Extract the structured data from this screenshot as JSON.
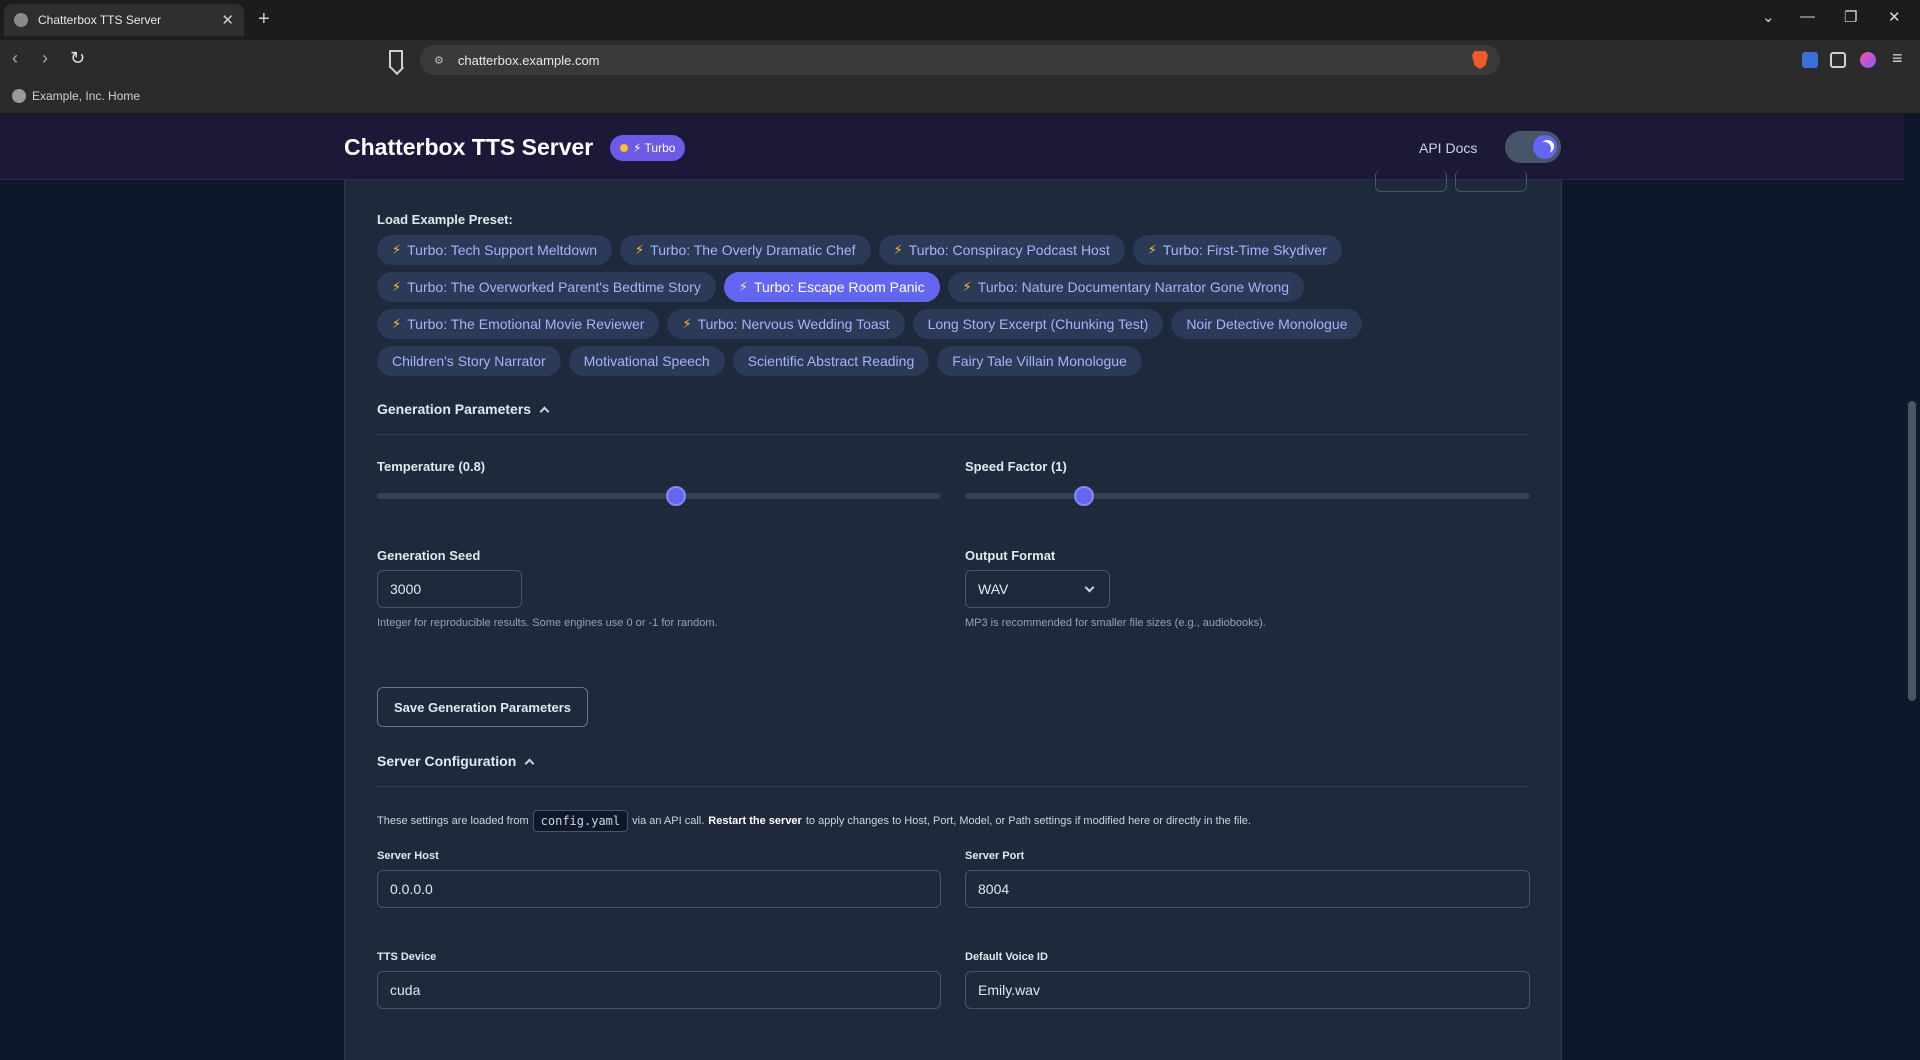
{
  "browser": {
    "tab_title": "Chatterbox TTS Server",
    "url": "chatterbox.example.com",
    "bookmark": "Example, Inc. Home"
  },
  "header": {
    "title": "Chatterbox TTS Server",
    "badge": "⚡ Turbo",
    "api_docs": "API Docs"
  },
  "presets": {
    "label": "Load Example Preset:",
    "rows": [
      [
        {
          "label": "Turbo: Tech Support Meltdown",
          "bolt": true
        },
        {
          "label": "Turbo: The Overly Dramatic Chef",
          "bolt": true
        },
        {
          "label": "Turbo: Conspiracy Podcast Host",
          "bolt": true
        },
        {
          "label": "Turbo: First-Time Skydiver",
          "bolt": true
        }
      ],
      [
        {
          "label": "Turbo: The Overworked Parent's Bedtime Story",
          "bolt": true
        },
        {
          "label": "Turbo: Escape Room Panic",
          "bolt": true,
          "active": true
        },
        {
          "label": "Turbo: Nature Documentary Narrator Gone Wrong",
          "bolt": true
        }
      ],
      [
        {
          "label": "Turbo: The Emotional Movie Reviewer",
          "bolt": true
        },
        {
          "label": "Turbo: Nervous Wedding Toast",
          "bolt": true
        },
        {
          "label": "Long Story Excerpt (Chunking Test)",
          "bolt": false
        },
        {
          "label": "Noir Detective Monologue",
          "bolt": false
        }
      ],
      [
        {
          "label": "Children's Story Narrator",
          "bolt": false
        },
        {
          "label": "Motivational Speech",
          "bolt": false
        },
        {
          "label": "Scientific Abstract Reading",
          "bolt": false
        },
        {
          "label": "Fairy Tale Villain Monologue",
          "bolt": false
        }
      ]
    ]
  },
  "generation": {
    "section_title": "Generation Parameters",
    "temperature_label": "Temperature (0.8)",
    "temperature_fraction": 0.53,
    "speed_label": "Speed Factor (1)",
    "speed_fraction": 0.21,
    "seed_label": "Generation Seed",
    "seed_value": "3000",
    "seed_help": "Integer for reproducible results. Some engines use 0 or -1 for random.",
    "format_label": "Output Format",
    "format_value": "WAV",
    "format_help": "MP3 is recommended for smaller file sizes (e.g., audiobooks).",
    "save_button": "Save Generation Parameters"
  },
  "server": {
    "section_title": "Server Configuration",
    "note_prefix": "These settings are loaded from",
    "note_code": "config.yaml",
    "note_mid": "via an API call.",
    "note_bold": "Restart the server",
    "note_suffix": "to apply changes to Host, Port, Model, or Path settings if modified here or directly in the file.",
    "host_label": "Server Host",
    "host_value": "0.0.0.0",
    "port_label": "Server Port",
    "port_value": "8004",
    "device_label": "TTS Device",
    "device_value": "cuda",
    "voice_label": "Default Voice ID",
    "voice_value": "Emily.wav"
  },
  "colors": {
    "accent": "#6366f1",
    "card_bg": "#1e293b",
    "page_bg": "#0f172a",
    "header_bg": "#1b1838",
    "bolt": "#fbbf24"
  }
}
